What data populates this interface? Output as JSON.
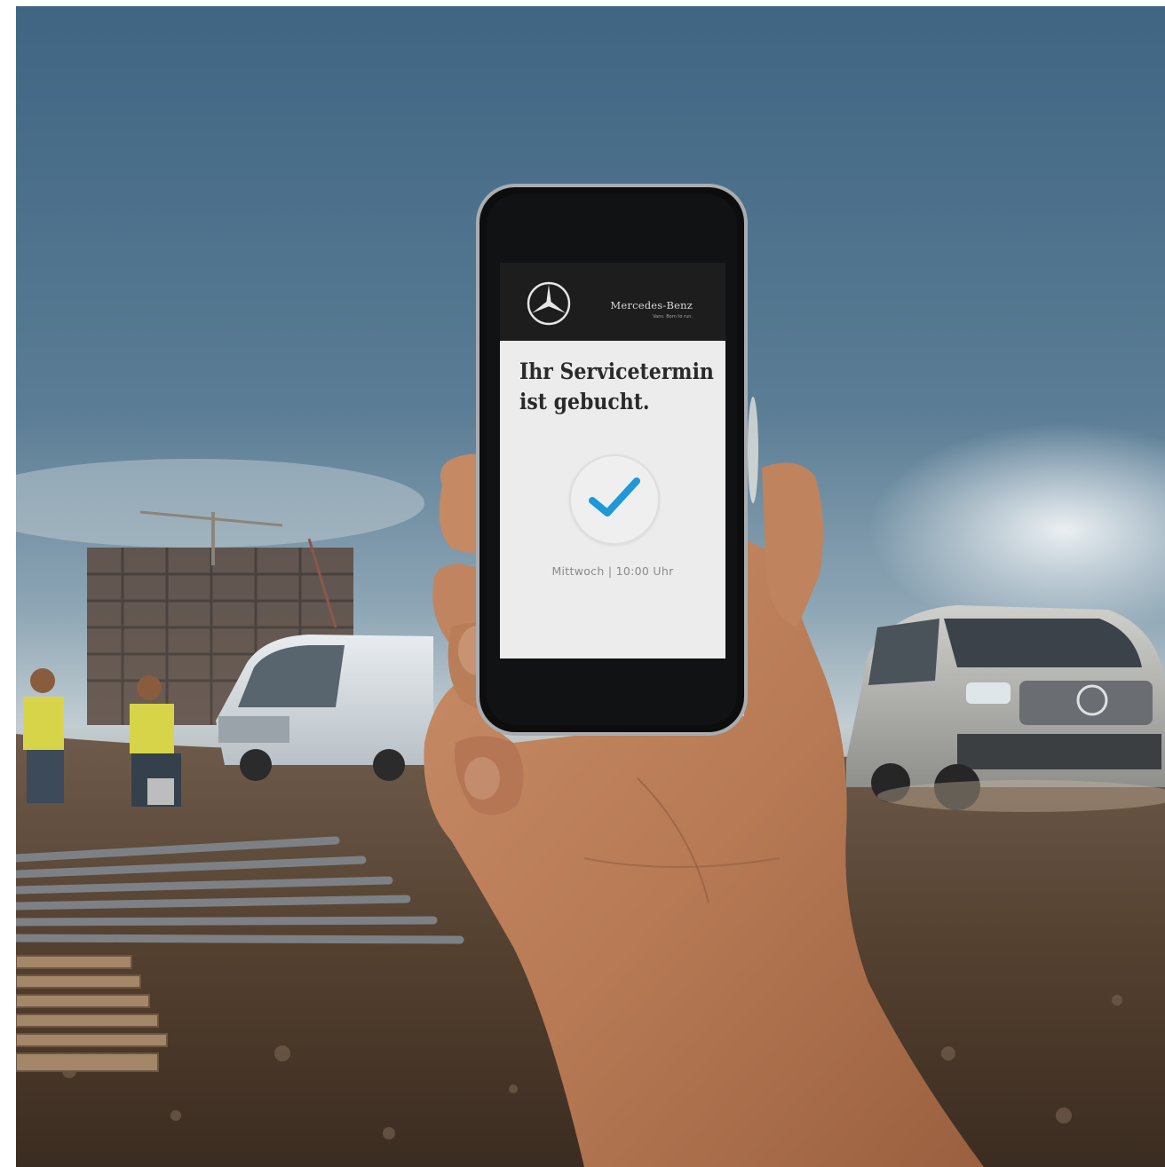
{
  "app": {
    "brand_name": "Mercedes-Benz",
    "brand_claim": "Vans. Born to run.",
    "headline_line1": "Ihr Servicetermin",
    "headline_line2": "ist gebucht.",
    "appointment_text": "Mittwoch  |  10:00 Uhr"
  },
  "icons": {
    "logo": "mercedes-star-icon",
    "confirmation": "checkmark-icon"
  },
  "colors": {
    "header_bg": "#1d1d1d",
    "screen_bg": "#ececec",
    "checkmark": "#1e98d7",
    "sky": "#3f6583",
    "ground": "#5b4535"
  }
}
